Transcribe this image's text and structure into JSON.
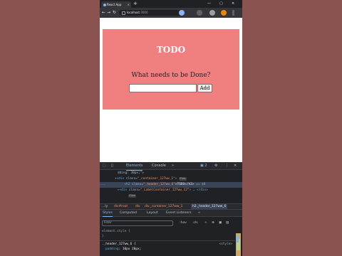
{
  "browser": {
    "tab_title": "React App",
    "new_tab_label": "+",
    "window_controls": {
      "minimize": "—",
      "maximize": "▢",
      "close": "✕"
    },
    "nav": {
      "back": "←",
      "forward": "→",
      "reload": "↻"
    },
    "url_host": "localhost",
    "url_port": ":3000"
  },
  "page": {
    "header": "TODO",
    "question": "What needs to be Done?",
    "input_value": "",
    "add_button": "Add"
  },
  "devtools": {
    "tabs": [
      "Elements",
      "Console",
      "»"
    ],
    "active_tab": "Elements",
    "issues_count": "2",
    "dom": {
      "line1": "dding: 30px;\">",
      "line2_tag_open": "<div ",
      "line2_attr": "class=",
      "line2_val": "\"_container_127ww_1\"",
      "line2_tag_close": ">",
      "line3_prefix": "...",
      "line3_tag_open": "<h2 ",
      "line3_attr": "class=",
      "line3_val": "\"_header_127ww_6\"",
      "line3_text": ">TODO</h2>",
      "line3_suffix": " == $0",
      "line4_tag_open": "<div ",
      "line4_attr": "class=",
      "line4_val": "\"_LabelContainer_127ww_12\"",
      "line4_tag_close": "> … </div>",
      "flex_badge": "flex"
    },
    "breadcrumbs": [
      "…ly",
      "div#root",
      "div",
      "div._container_127ww_1",
      "h2._header_127ww_6"
    ],
    "style_tabs": [
      "Styles",
      "Computed",
      "Layout",
      "Event Listeners",
      "»"
    ],
    "active_style_tab": "Styles",
    "filter_placeholder": "Filter",
    "filter_tools": [
      ":hov",
      ".cls",
      "+"
    ],
    "rules": {
      "element_style": "element.style {",
      "element_style_close": "}",
      "header_selector": "._header_127ww_6 {",
      "header_source": "<style>",
      "prop1_name": "padding",
      "prop1_value": "10px 20px;"
    }
  }
}
